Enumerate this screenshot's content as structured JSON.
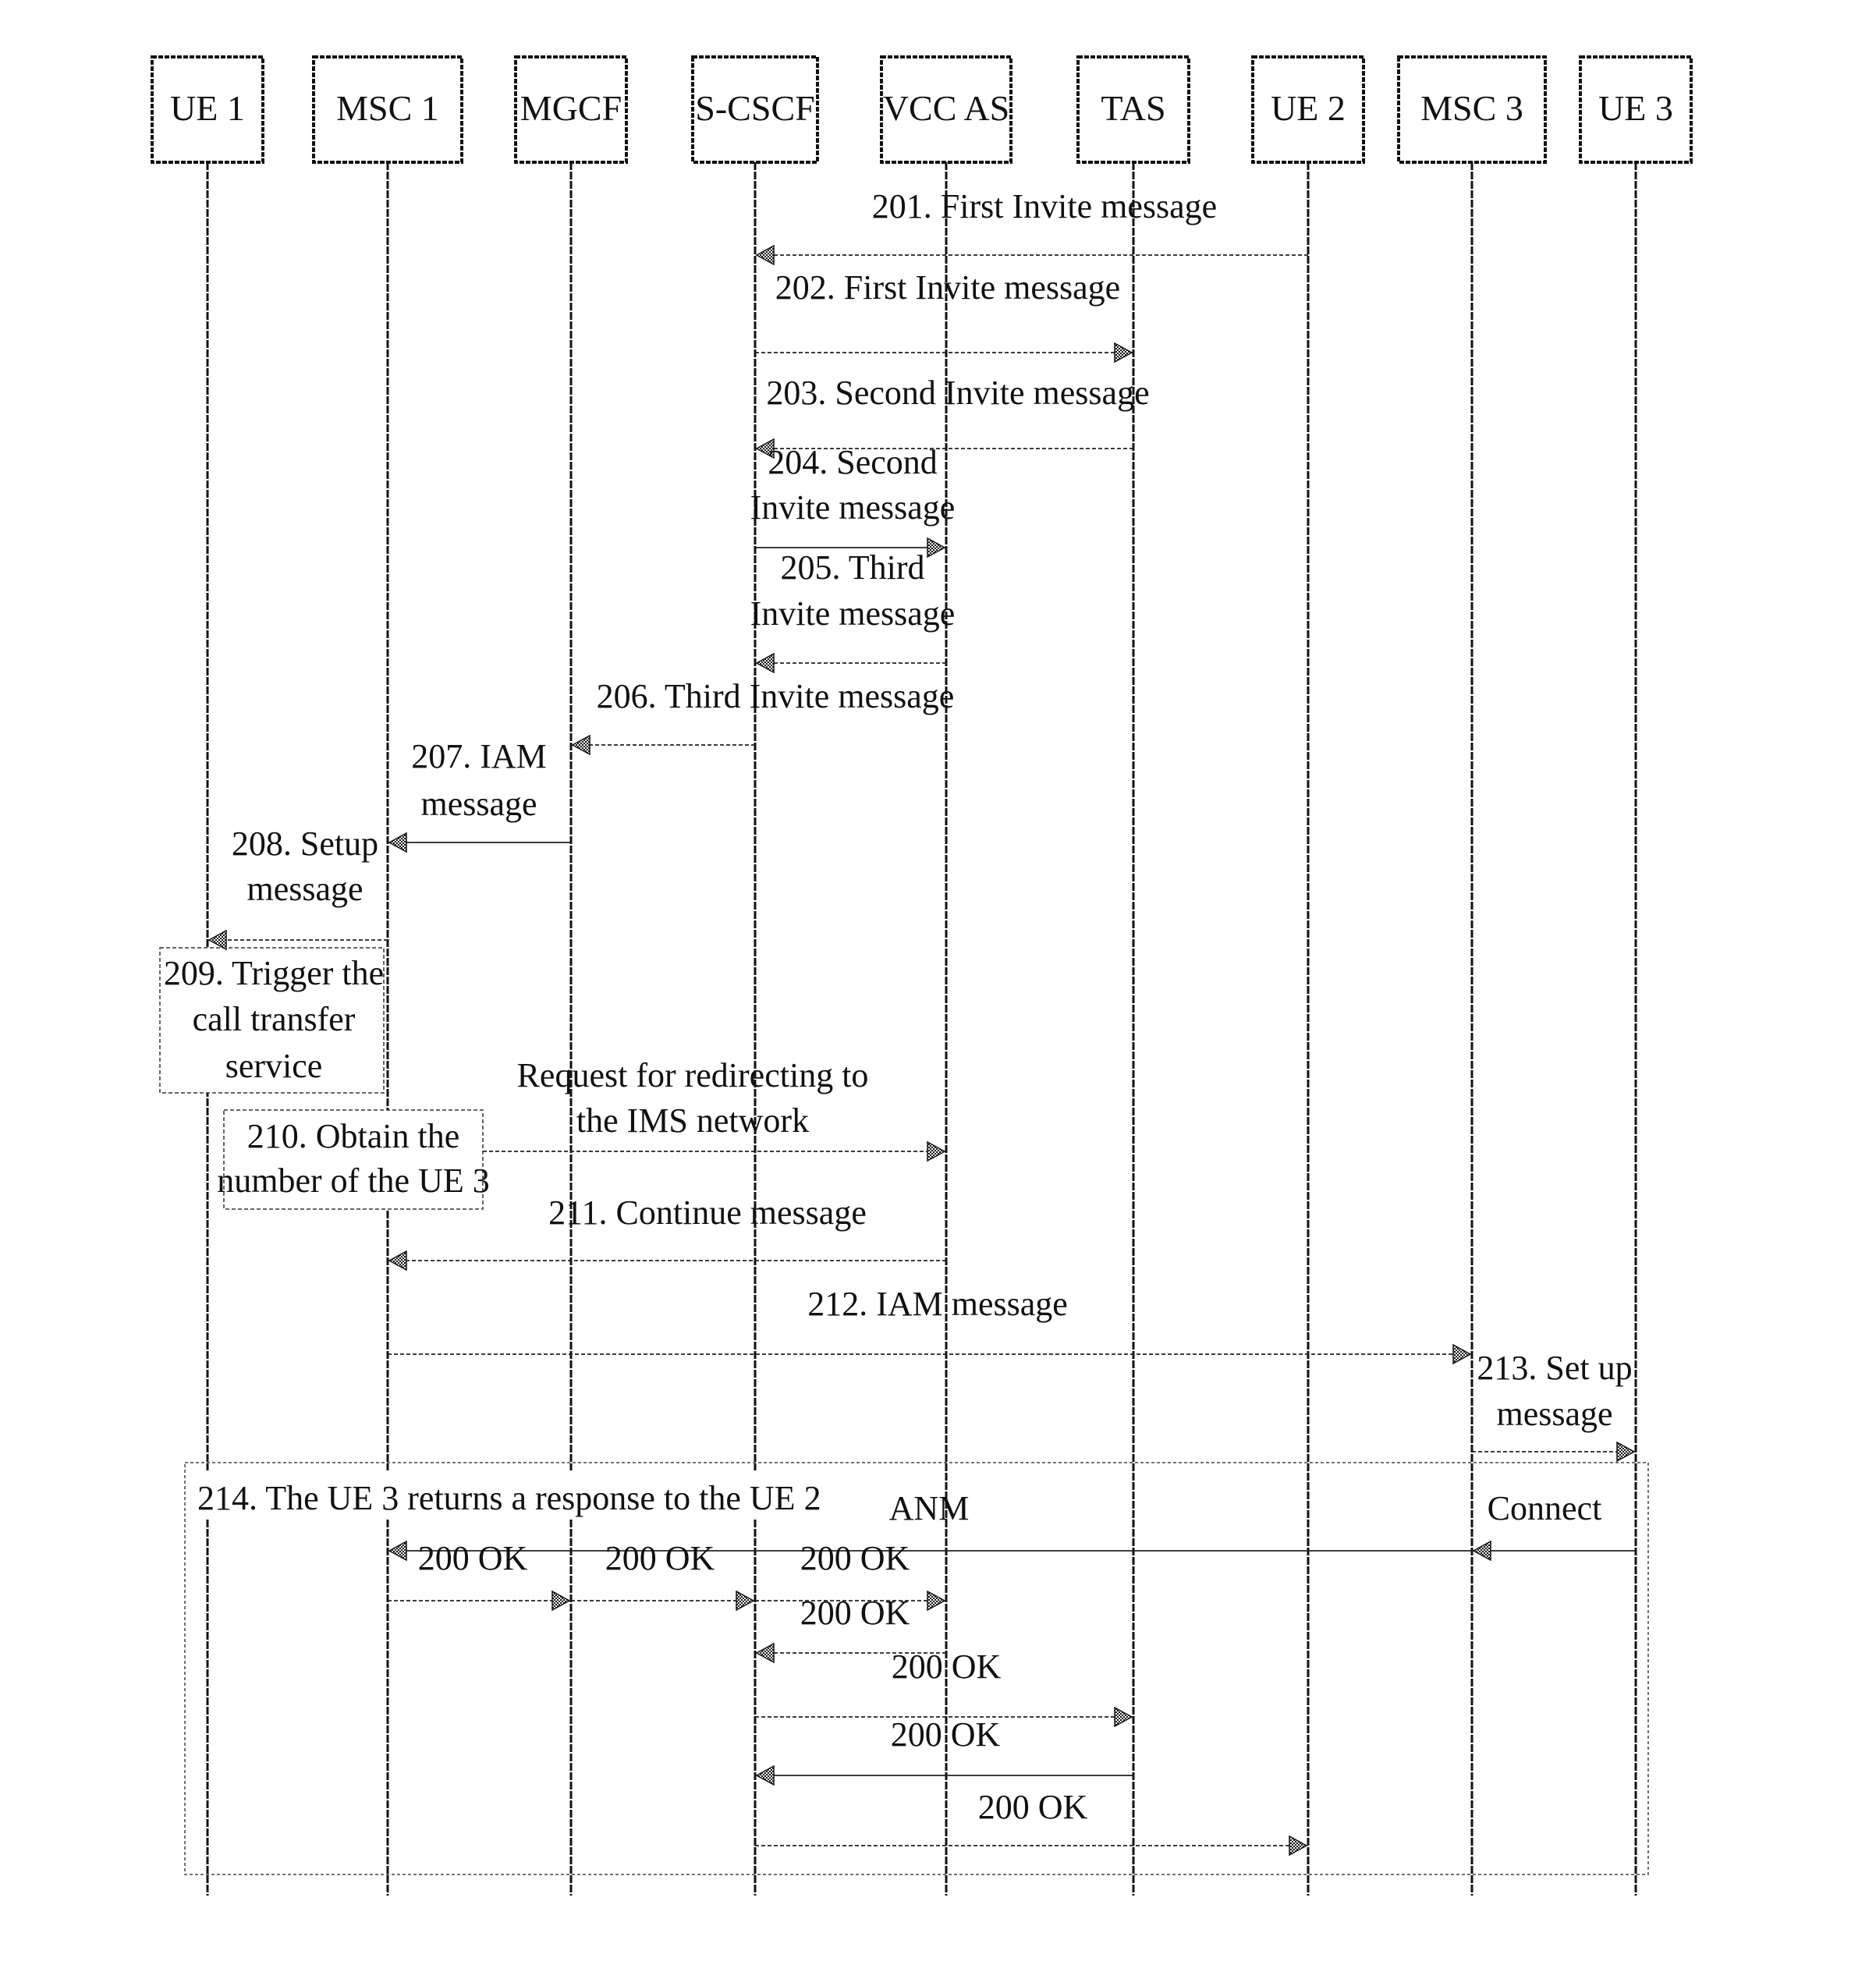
{
  "participants": [
    {
      "id": "ue1",
      "label": "UE 1"
    },
    {
      "id": "msc1",
      "label": "MSC 1"
    },
    {
      "id": "mgcf",
      "label": "MGCF"
    },
    {
      "id": "scscf",
      "label": "S-CSCF"
    },
    {
      "id": "vccas",
      "label": "VCC AS"
    },
    {
      "id": "tas",
      "label": "TAS"
    },
    {
      "id": "ue2",
      "label": "UE 2"
    },
    {
      "id": "msc3",
      "label": "MSC 3"
    },
    {
      "id": "ue3",
      "label": "UE 3"
    }
  ],
  "messages": [
    {
      "from": "ue2",
      "to": "scscf",
      "lines": [
        "201. First Invite message"
      ],
      "style": "dashed"
    },
    {
      "from": "scscf",
      "to": "tas",
      "lines": [
        "202. First Invite message"
      ],
      "style": "dashed"
    },
    {
      "from": "tas",
      "to": "scscf",
      "lines": [
        "203. Second Invite message"
      ],
      "style": "dashed"
    },
    {
      "from": "scscf",
      "to": "vccas",
      "lines": [
        "204. Second",
        "Invite message"
      ],
      "style": "solid"
    },
    {
      "from": "vccas",
      "to": "scscf",
      "lines": [
        "205. Third",
        "Invite message"
      ],
      "style": "dashed"
    },
    {
      "from": "scscf",
      "to": "mgcf",
      "lines": [
        "206. Third Invite message"
      ],
      "style": "dashed"
    },
    {
      "from": "mgcf",
      "to": "msc1",
      "lines": [
        "207. IAM",
        "message"
      ],
      "style": "solid"
    },
    {
      "from": "msc1",
      "to": "ue1",
      "lines": [
        "208. Setup",
        "message"
      ],
      "style": "dashed"
    },
    {
      "from": "box210",
      "to": "vccas",
      "lines": [
        "Request for redirecting to",
        "the IMS network"
      ],
      "style": "dashed"
    },
    {
      "from": "vccas",
      "to": "msc1",
      "lines": [
        "211. Continue message"
      ],
      "style": "dashed"
    },
    {
      "from": "msc1",
      "to": "msc3",
      "lines": [
        "212. IAM message"
      ],
      "style": "dashed"
    },
    {
      "from": "msc3",
      "to": "ue3",
      "lines": [
        "213. Set up",
        "message"
      ],
      "style": "dashed"
    },
    {
      "from": "ue3",
      "to": "msc1",
      "lines": [
        "ANM"
      ],
      "style": "solid"
    },
    {
      "from": "msc1",
      "to": "mgcf",
      "lines": [
        "200 OK"
      ],
      "style": "dashed"
    },
    {
      "from": "mgcf",
      "to": "scscf",
      "lines": [
        "200 OK"
      ],
      "style": "dashed"
    },
    {
      "from": "scscf",
      "to": "vccas",
      "lines": [
        "200 OK"
      ],
      "style": "dashed"
    },
    {
      "from": "vccas",
      "to": "scscf",
      "lines": [
        "200 OK"
      ],
      "style": "dashed"
    },
    {
      "from": "scscf",
      "to": "tas",
      "lines": [
        "200 OK"
      ],
      "style": "dashed"
    },
    {
      "from": "tas",
      "to": "scscf",
      "lines": [
        "200 OK"
      ],
      "style": "solid"
    },
    {
      "from": "scscf",
      "to": "ue2",
      "lines": [
        "200 OK"
      ],
      "style": "dashed"
    }
  ],
  "notes": {
    "n209": [
      "209. Trigger the",
      "call transfer",
      "service"
    ],
    "n210": [
      "210. Obtain the",
      "number of the UE 3"
    ],
    "n214": "214. The UE 3 returns a response to the UE 2",
    "connect": "Connect"
  }
}
